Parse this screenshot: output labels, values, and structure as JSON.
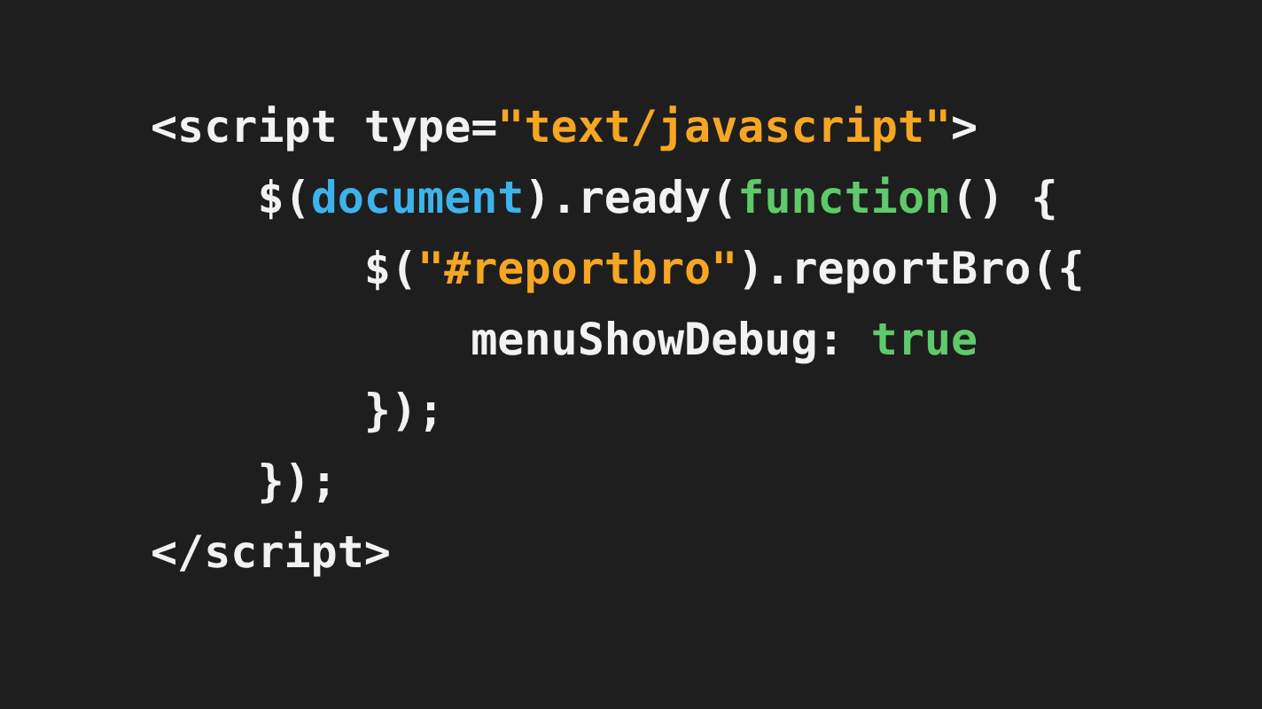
{
  "code_lines": [
    {
      "tokens": [
        {
          "kind": "plain",
          "text": "<script type="
        },
        {
          "kind": "string",
          "text": "\"text/javascript\""
        },
        {
          "kind": "plain",
          "text": ">"
        }
      ]
    },
    {
      "tokens": [
        {
          "kind": "plain",
          "text": "    $("
        },
        {
          "kind": "object",
          "text": "document"
        },
        {
          "kind": "plain",
          "text": ").ready("
        },
        {
          "kind": "keyword",
          "text": "function"
        },
        {
          "kind": "plain",
          "text": "() {"
        }
      ]
    },
    {
      "tokens": [
        {
          "kind": "plain",
          "text": "        $("
        },
        {
          "kind": "string",
          "text": "\"#reportbro\""
        },
        {
          "kind": "plain",
          "text": ").reportBro({"
        }
      ]
    },
    {
      "tokens": [
        {
          "kind": "plain",
          "text": "            menuShowDebug: "
        },
        {
          "kind": "keyword",
          "text": "true"
        }
      ]
    },
    {
      "tokens": [
        {
          "kind": "plain",
          "text": "        });"
        }
      ]
    },
    {
      "tokens": [
        {
          "kind": "plain",
          "text": "    });"
        }
      ]
    },
    {
      "tokens": [
        {
          "kind": "plain",
          "text": "</script>"
        }
      ]
    }
  ]
}
